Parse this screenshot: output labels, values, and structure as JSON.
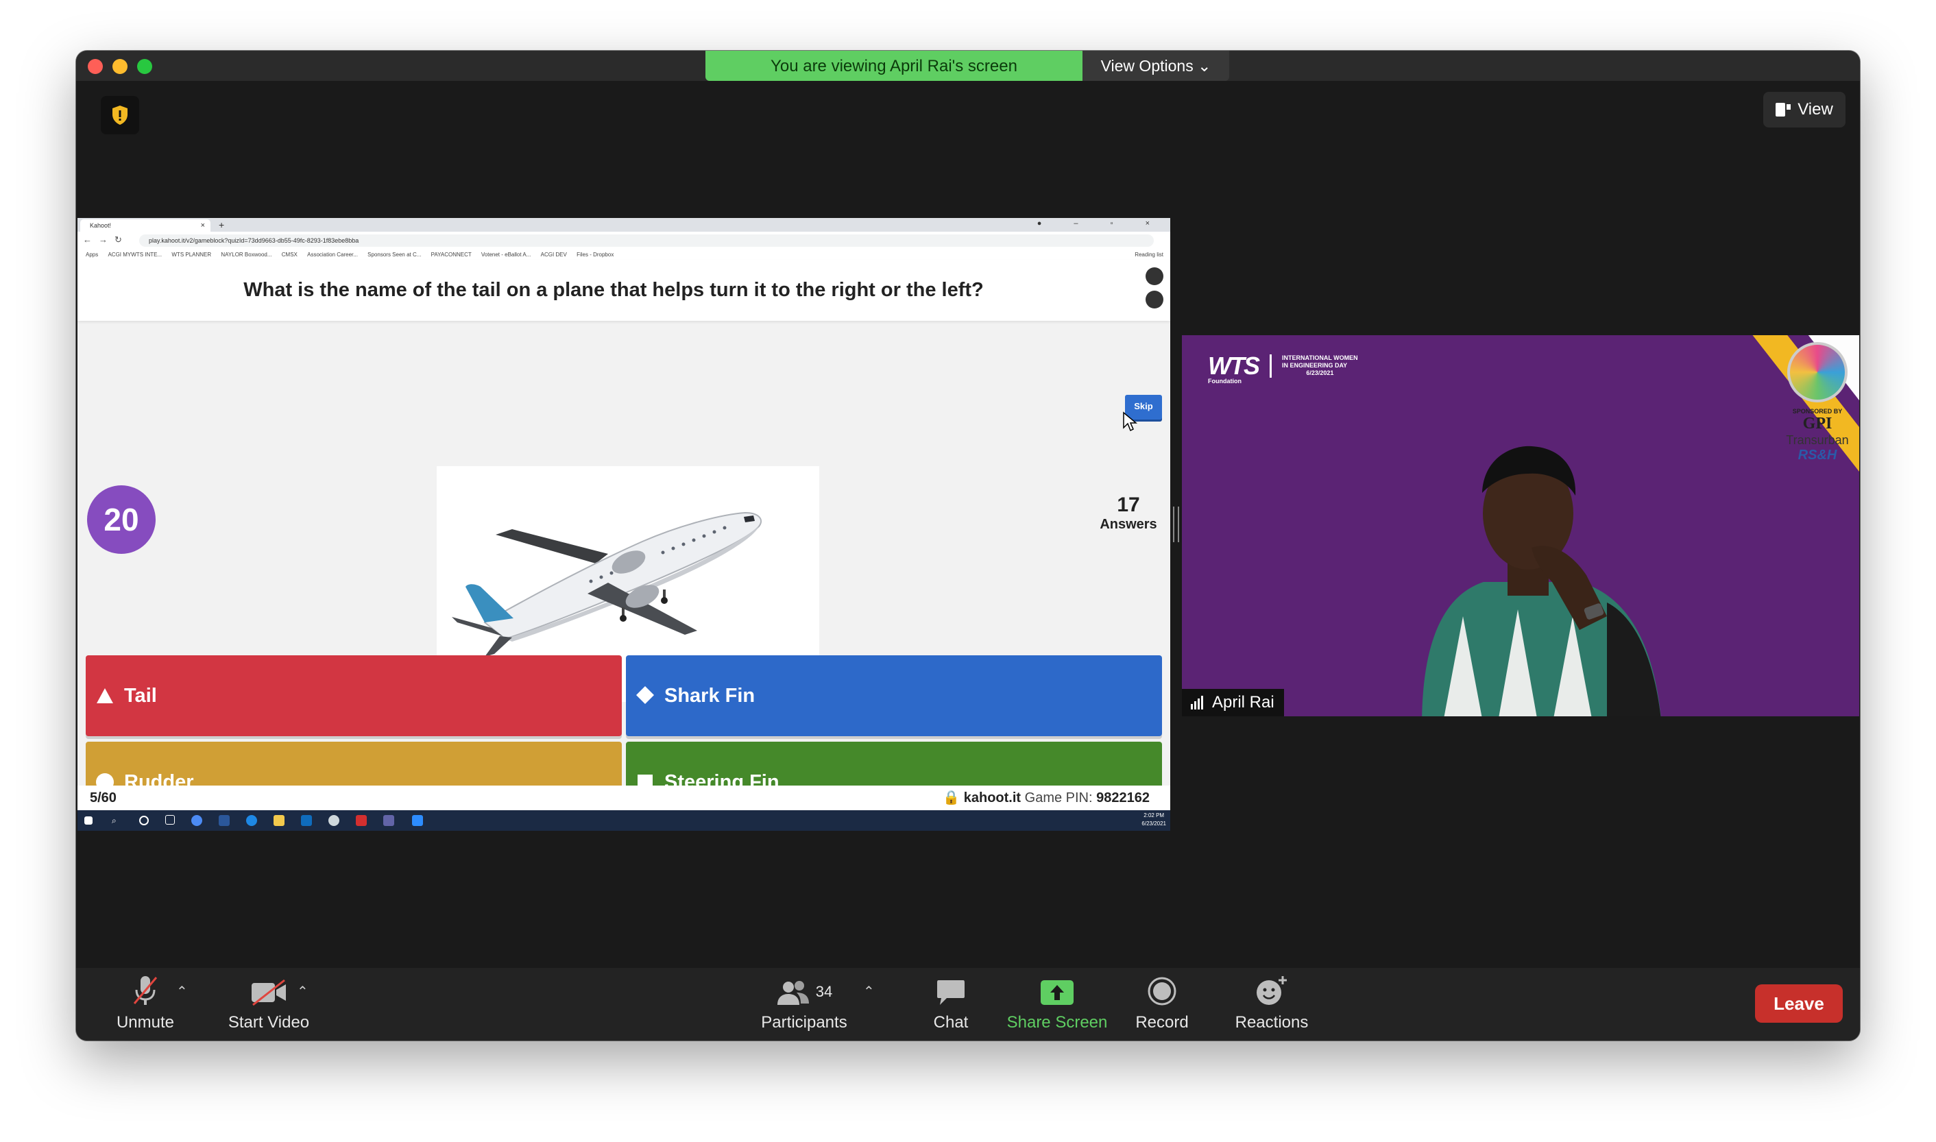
{
  "meeting": {
    "viewing_banner": "You are viewing April Rai's screen",
    "view_options": "View Options",
    "view_button": "View"
  },
  "browser": {
    "tab_title": "Kahoot!",
    "url": "play.kahoot.it/v2/gameblock?quizId=73dd9663-db55-49fc-8293-1f83ebe8bba",
    "bookmarks": [
      "Apps",
      "ACGI MYWTS INTE...",
      "WTS PLANNER",
      "NAYLOR Boxwood...",
      "CMSX",
      "Association Career...",
      "Sponsors Seen at C...",
      "PAYACONNECT",
      "Votenet - eBallot A...",
      "ACGI DEV",
      "Files - Dropbox"
    ],
    "reading_list": "Reading list"
  },
  "kahoot": {
    "question": "What is the name of the tail on a plane that helps turn it to the right or the left?",
    "timer": "20",
    "answers_count": "17",
    "answers_label": "Answers",
    "skip_label": "Skip",
    "options": [
      {
        "label": "Tail",
        "shape": "triangle",
        "color": "#d23642"
      },
      {
        "label": "Shark Fin",
        "shape": "diamond",
        "color": "#2d69c9"
      },
      {
        "label": "Rudder",
        "shape": "circle",
        "color": "#d09f35"
      },
      {
        "label": "Steering Fin",
        "shape": "square",
        "color": "#45892a"
      }
    ],
    "progress": "5/60",
    "site": "kahoot.it",
    "pin_prefix": "Game PIN:",
    "pin": "9822162"
  },
  "taskbar": {
    "time": "2:02 PM",
    "date": "6/23/2021"
  },
  "video": {
    "participant_name": "April Rai",
    "logo_text": "WTS",
    "logo_sub": "Foundation",
    "event_line1": "INTERNATIONAL WOMEN",
    "event_line2": "IN ENGINEERING DAY",
    "event_date": "6/23/2021",
    "sponsored_by": "SPONSORED BY",
    "sponsors": [
      "GPI",
      "Transurban",
      "RS&H"
    ]
  },
  "toolbar": {
    "unmute": "Unmute",
    "start_video": "Start Video",
    "participants": "Participants",
    "participants_count": "34",
    "chat": "Chat",
    "share_screen": "Share Screen",
    "record": "Record",
    "reactions": "Reactions",
    "leave": "Leave"
  }
}
